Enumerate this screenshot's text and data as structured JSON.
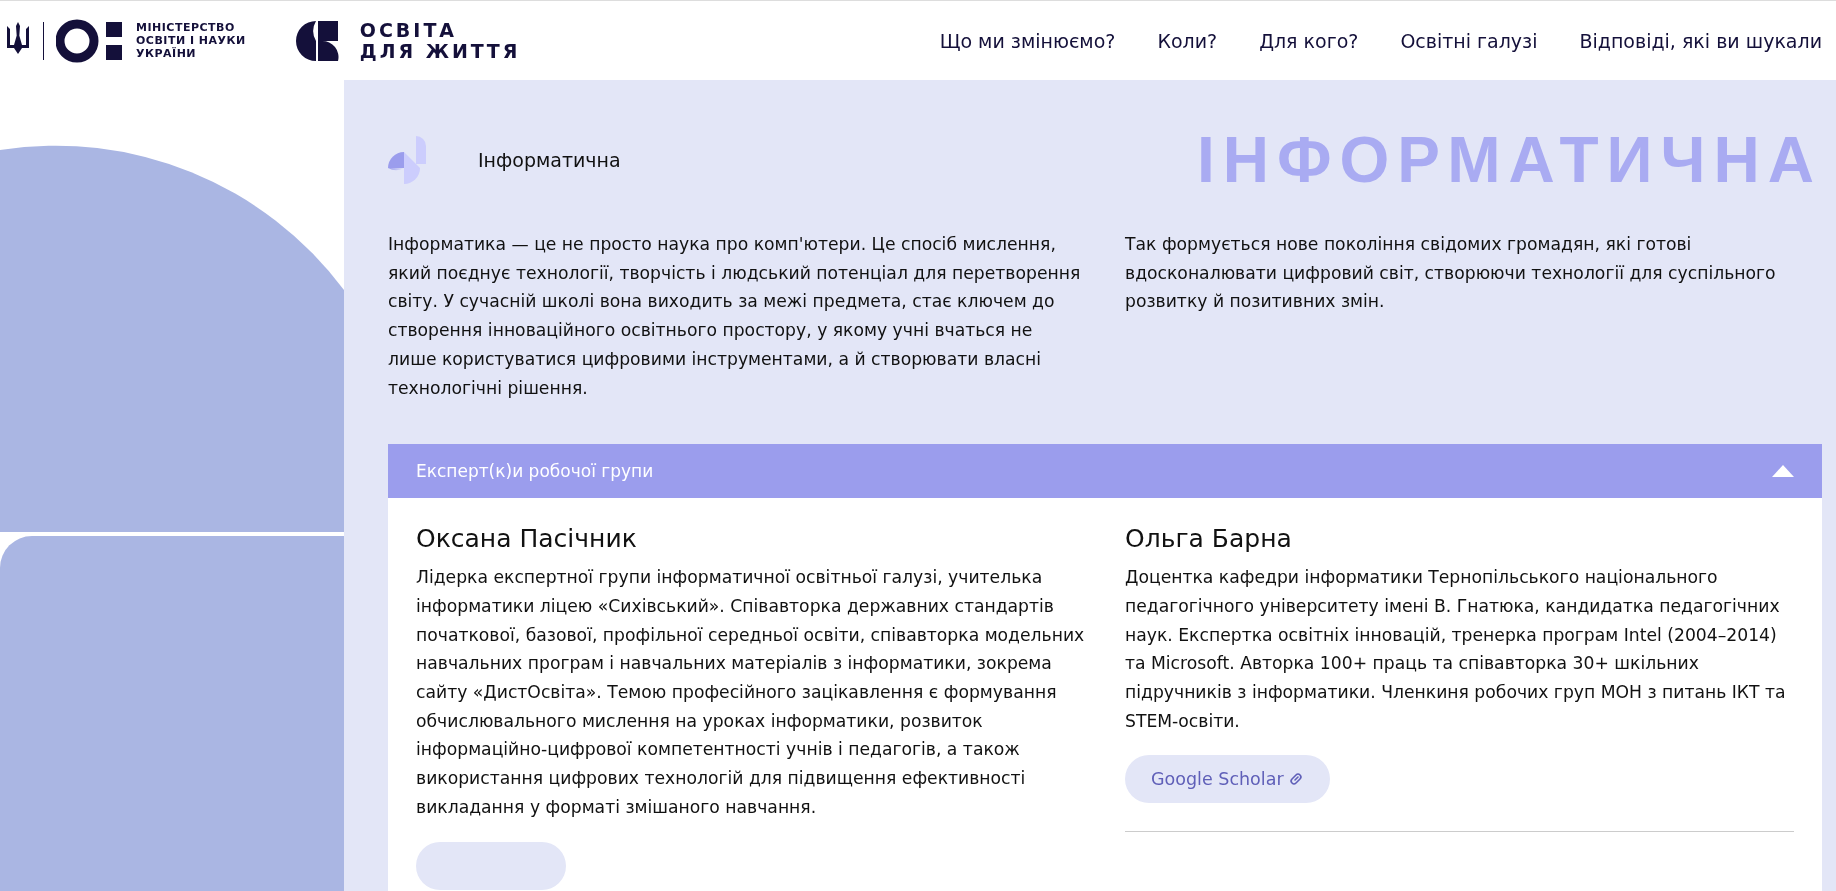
{
  "header": {
    "ministry_logo_lines": [
      "МІНІСТЕРСТВО",
      "ОСВІТИ І НАУКИ",
      "УКРАЇНИ"
    ],
    "brand_logo_lines": [
      "ОСВІТА",
      "ДЛЯ ЖИТТЯ"
    ],
    "nav": [
      {
        "label": "Що ми змінюємо?"
      },
      {
        "label": "Коли?"
      },
      {
        "label": "Для кого?"
      },
      {
        "label": "Освітні галузі"
      },
      {
        "label": "Відповіді, які ви шукали"
      }
    ]
  },
  "section": {
    "title": "Інформатична",
    "banner": "ІНФОРМАТИЧНА",
    "paragraphs": [
      "Інформатика — це не просто наука про комп'ютери. Це спосіб мислення, який поєднує технології, творчість і людський потенціал для перетворення світу. У сучасній школі вона виходить за межі предмета, стає ключем до створення інноваційного освітнього простору, у якому учні вчаться не лише користуватися цифровими інструментами, а й створювати власні технологічні рішення.",
      "Так формується нове покоління свідомих громадян, які готові вдосконалювати цифровий світ, створюючи технології для суспільного розвитку й позитивних змін."
    ]
  },
  "accordion": {
    "title": "Експерт(к)и робочої групи",
    "expanded": true,
    "experts": [
      {
        "name": "Оксана Пасічник",
        "bio": "Лідерка експертної групи інформатичної освітньої галузі, учителька інформатики ліцею «Сихівський». Співавторка державних стандартів початкової, базової, профільної середньої освіти, співавторка модельних навчальних програм і навчальних матеріалів з інформатики, зокрема сайту «ДистОсвіта». Темою професійного зацікавлення є формування обчислювального мислення на уроках інформатики, розвиток інформаційно-цифрової компетентності учнів і педагогів, а також використання цифрових технологій для підвищення ефективності викладання у форматі змішаного навчання.",
        "link_button": true
      },
      {
        "name": "Ольга Барна",
        "bio": "Доцентка кафедри інформатики Тернопільського національного педагогічного університету імені В. Гнатюка, кандидатка педагогічних наук. Експертка освітніх інновацій, тренерка програм Intel (2004–2014) та Microsoft. Авторка 100+ праць та співавторка 30+ шкільних підручників з інформатики. Членкиня робочих груп МОН з питань ІКТ та STEM-освіти.",
        "link_button": true,
        "link_label": "Google Scholar"
      }
    ]
  }
}
